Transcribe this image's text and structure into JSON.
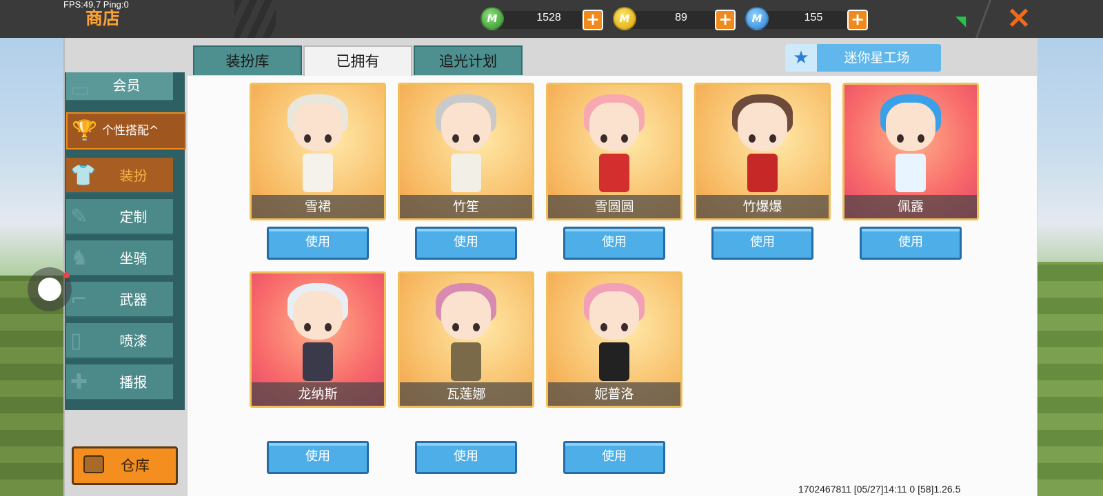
{
  "debug": {
    "fps_text": "FPS:49.7  Ping:0"
  },
  "header": {
    "title": "商店",
    "currencies": [
      {
        "icon": "mini-bean-icon",
        "letter": "M",
        "value": "1528"
      },
      {
        "icon": "mini-coin-icon",
        "letter": "M",
        "value": "89"
      },
      {
        "icon": "mini-point-icon",
        "letter": "M",
        "value": "155"
      }
    ],
    "plus": "+",
    "close": "✕"
  },
  "tabs": [
    {
      "label": "装扮库"
    },
    {
      "label": "已拥有"
    },
    {
      "label": "追光计划"
    }
  ],
  "mini_workshop": {
    "label": "迷你星工场",
    "icon": "★"
  },
  "sidebar": {
    "member": "会员",
    "group": "个性搭配^",
    "items": [
      {
        "label": "装扮",
        "icon": "shirt-icon"
      },
      {
        "label": "定制",
        "icon": "pencil-icon"
      },
      {
        "label": "坐骑",
        "icon": "mount-icon"
      },
      {
        "label": "武器",
        "icon": "gun-icon"
      },
      {
        "label": "喷漆",
        "icon": "spray-icon"
      },
      {
        "label": "播报",
        "icon": "broadcast-icon"
      }
    ],
    "warehouse": "仓库"
  },
  "skins": [
    {
      "name": "雪裙",
      "bg": "gold",
      "hair": "#e9e6dc",
      "outfit": "#f4f2ea"
    },
    {
      "name": "竹笙",
      "bg": "gold",
      "hair": "#c9c9c9",
      "outfit": "#f2efe6"
    },
    {
      "name": "雪圆圆",
      "bg": "gold",
      "hair": "#f7a8b0",
      "outfit": "#d32f2f"
    },
    {
      "name": "竹爆爆",
      "bg": "gold",
      "hair": "#6d4a3a",
      "outfit": "#c62828"
    },
    {
      "name": "佩露",
      "bg": "red",
      "hair": "#3aa0e8",
      "outfit": "#e8f4ff"
    },
    {
      "name": "龙纳斯",
      "bg": "red",
      "hair": "#e8eef4",
      "outfit": "#3a3a4a"
    },
    {
      "name": "瓦莲娜",
      "bg": "gold",
      "hair": "#d98ab0",
      "outfit": "#7a6a4a"
    },
    {
      "name": "妮普洛",
      "bg": "gold",
      "hair": "#f2a0b8",
      "outfit": "#222222"
    }
  ],
  "use_label": "使用",
  "footer_stamp": "1702467811    [05/27]14:11 0    [58]1.26.5"
}
